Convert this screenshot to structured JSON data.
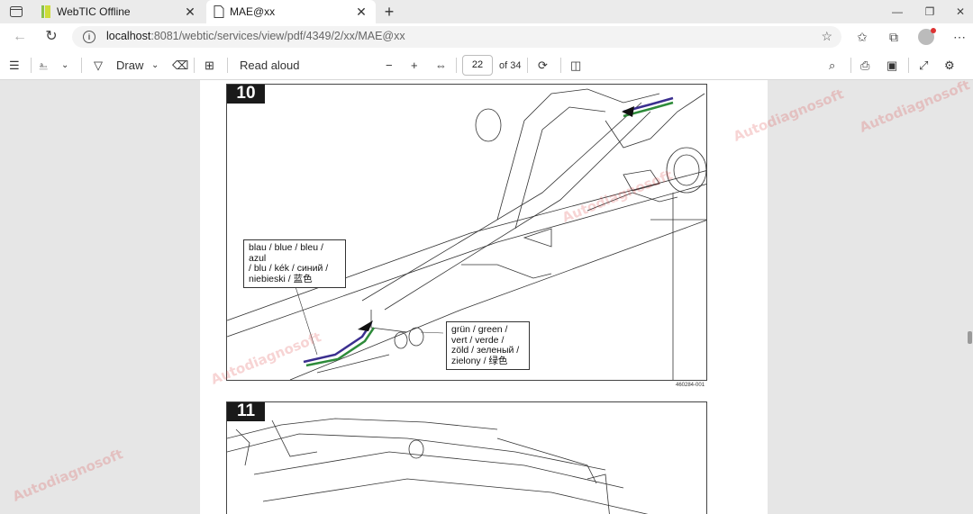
{
  "tabs": [
    {
      "title": "WebTIC Offline",
      "active": false
    },
    {
      "title": "MAE@xx",
      "active": true
    }
  ],
  "address": {
    "host": "localhost",
    "path": ":8081/webtic/services/view/pdf/4349/2/xx/MAE@xx"
  },
  "pdf_toolbar": {
    "draw_label": "Draw",
    "read_aloud_label": "Read aloud",
    "current_page": "22",
    "total_pages": "of 34"
  },
  "document": {
    "step_10": "10",
    "step_11": "11",
    "callout_blue": [
      "blau / blue / bleu / azul",
      "/ blu / kék / синий /",
      "niebieski / 蓝色"
    ],
    "callout_green": [
      "grün / green /",
      "vert / verde /",
      "zöld / зеленый /",
      "zielony / 绿色"
    ],
    "figure_ref": "460284-001",
    "watermark_text": "Autodiagnosoft"
  },
  "colors": {
    "wire_blue": "#3b2f8f",
    "wire_green": "#2e8b3a",
    "badge": "#1a1a1a",
    "accent": "#0067c0"
  }
}
